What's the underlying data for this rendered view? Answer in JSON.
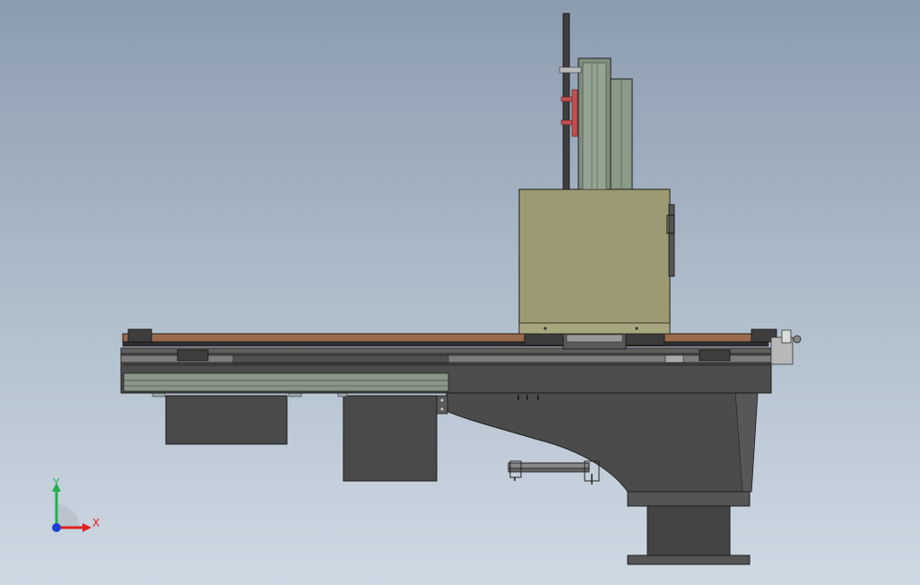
{
  "triad": {
    "y_label": "Y",
    "x_label": "X",
    "colors": {
      "y_axis": "#22b14c",
      "x_axis": "#e02020",
      "z_axis": "#1f3fd0"
    }
  },
  "colors": {
    "background_top": "#8c9cb0",
    "background_bottom": "#cfd9e4",
    "dark_frame": "#4a4a4a",
    "rail_green": "#8a9688",
    "wood_strip": "#9a6a4c",
    "head_box": "#9c9a72",
    "column_green": "#7f8f7c",
    "accent_red": "#c05050"
  }
}
